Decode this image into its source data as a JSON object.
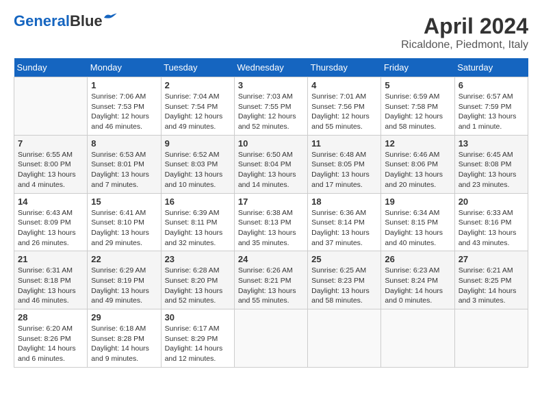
{
  "logo": {
    "part1": "General",
    "part2": "Blue"
  },
  "title": "April 2024",
  "subtitle": "Ricaldone, Piedmont, Italy",
  "days_header": [
    "Sunday",
    "Monday",
    "Tuesday",
    "Wednesday",
    "Thursday",
    "Friday",
    "Saturday"
  ],
  "weeks": [
    [
      {
        "day": "",
        "info": ""
      },
      {
        "day": "1",
        "info": "Sunrise: 7:06 AM\nSunset: 7:53 PM\nDaylight: 12 hours\nand 46 minutes."
      },
      {
        "day": "2",
        "info": "Sunrise: 7:04 AM\nSunset: 7:54 PM\nDaylight: 12 hours\nand 49 minutes."
      },
      {
        "day": "3",
        "info": "Sunrise: 7:03 AM\nSunset: 7:55 PM\nDaylight: 12 hours\nand 52 minutes."
      },
      {
        "day": "4",
        "info": "Sunrise: 7:01 AM\nSunset: 7:56 PM\nDaylight: 12 hours\nand 55 minutes."
      },
      {
        "day": "5",
        "info": "Sunrise: 6:59 AM\nSunset: 7:58 PM\nDaylight: 12 hours\nand 58 minutes."
      },
      {
        "day": "6",
        "info": "Sunrise: 6:57 AM\nSunset: 7:59 PM\nDaylight: 13 hours\nand 1 minute."
      }
    ],
    [
      {
        "day": "7",
        "info": "Sunrise: 6:55 AM\nSunset: 8:00 PM\nDaylight: 13 hours\nand 4 minutes."
      },
      {
        "day": "8",
        "info": "Sunrise: 6:53 AM\nSunset: 8:01 PM\nDaylight: 13 hours\nand 7 minutes."
      },
      {
        "day": "9",
        "info": "Sunrise: 6:52 AM\nSunset: 8:03 PM\nDaylight: 13 hours\nand 10 minutes."
      },
      {
        "day": "10",
        "info": "Sunrise: 6:50 AM\nSunset: 8:04 PM\nDaylight: 13 hours\nand 14 minutes."
      },
      {
        "day": "11",
        "info": "Sunrise: 6:48 AM\nSunset: 8:05 PM\nDaylight: 13 hours\nand 17 minutes."
      },
      {
        "day": "12",
        "info": "Sunrise: 6:46 AM\nSunset: 8:06 PM\nDaylight: 13 hours\nand 20 minutes."
      },
      {
        "day": "13",
        "info": "Sunrise: 6:45 AM\nSunset: 8:08 PM\nDaylight: 13 hours\nand 23 minutes."
      }
    ],
    [
      {
        "day": "14",
        "info": "Sunrise: 6:43 AM\nSunset: 8:09 PM\nDaylight: 13 hours\nand 26 minutes."
      },
      {
        "day": "15",
        "info": "Sunrise: 6:41 AM\nSunset: 8:10 PM\nDaylight: 13 hours\nand 29 minutes."
      },
      {
        "day": "16",
        "info": "Sunrise: 6:39 AM\nSunset: 8:11 PM\nDaylight: 13 hours\nand 32 minutes."
      },
      {
        "day": "17",
        "info": "Sunrise: 6:38 AM\nSunset: 8:13 PM\nDaylight: 13 hours\nand 35 minutes."
      },
      {
        "day": "18",
        "info": "Sunrise: 6:36 AM\nSunset: 8:14 PM\nDaylight: 13 hours\nand 37 minutes."
      },
      {
        "day": "19",
        "info": "Sunrise: 6:34 AM\nSunset: 8:15 PM\nDaylight: 13 hours\nand 40 minutes."
      },
      {
        "day": "20",
        "info": "Sunrise: 6:33 AM\nSunset: 8:16 PM\nDaylight: 13 hours\nand 43 minutes."
      }
    ],
    [
      {
        "day": "21",
        "info": "Sunrise: 6:31 AM\nSunset: 8:18 PM\nDaylight: 13 hours\nand 46 minutes."
      },
      {
        "day": "22",
        "info": "Sunrise: 6:29 AM\nSunset: 8:19 PM\nDaylight: 13 hours\nand 49 minutes."
      },
      {
        "day": "23",
        "info": "Sunrise: 6:28 AM\nSunset: 8:20 PM\nDaylight: 13 hours\nand 52 minutes."
      },
      {
        "day": "24",
        "info": "Sunrise: 6:26 AM\nSunset: 8:21 PM\nDaylight: 13 hours\nand 55 minutes."
      },
      {
        "day": "25",
        "info": "Sunrise: 6:25 AM\nSunset: 8:23 PM\nDaylight: 13 hours\nand 58 minutes."
      },
      {
        "day": "26",
        "info": "Sunrise: 6:23 AM\nSunset: 8:24 PM\nDaylight: 14 hours\nand 0 minutes."
      },
      {
        "day": "27",
        "info": "Sunrise: 6:21 AM\nSunset: 8:25 PM\nDaylight: 14 hours\nand 3 minutes."
      }
    ],
    [
      {
        "day": "28",
        "info": "Sunrise: 6:20 AM\nSunset: 8:26 PM\nDaylight: 14 hours\nand 6 minutes."
      },
      {
        "day": "29",
        "info": "Sunrise: 6:18 AM\nSunset: 8:28 PM\nDaylight: 14 hours\nand 9 minutes."
      },
      {
        "day": "30",
        "info": "Sunrise: 6:17 AM\nSunset: 8:29 PM\nDaylight: 14 hours\nand 12 minutes."
      },
      {
        "day": "",
        "info": ""
      },
      {
        "day": "",
        "info": ""
      },
      {
        "day": "",
        "info": ""
      },
      {
        "day": "",
        "info": ""
      }
    ]
  ]
}
